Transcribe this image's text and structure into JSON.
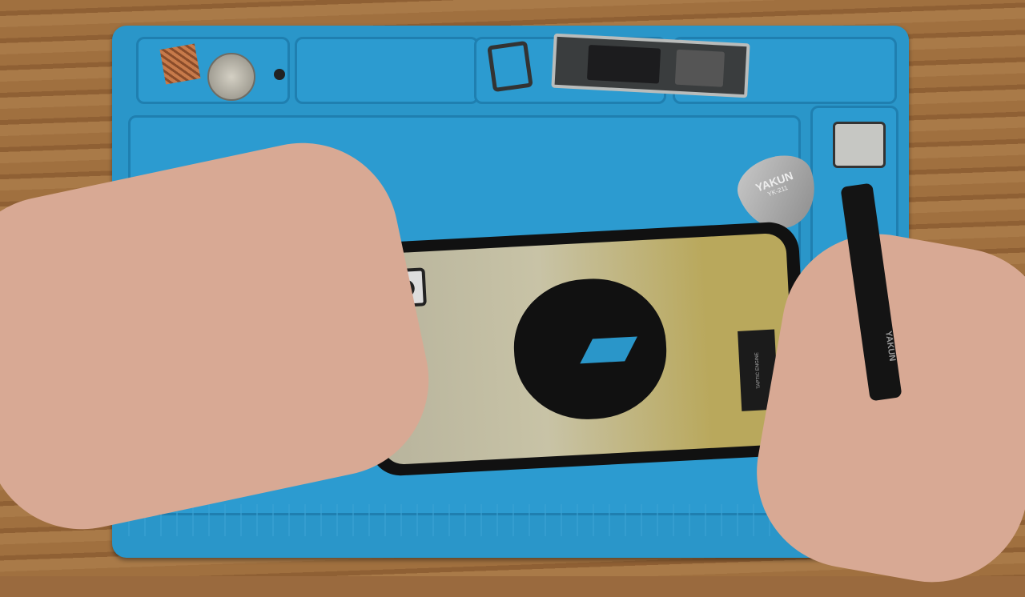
{
  "scene": {
    "description_labels": {
      "pick_brand": "YAKUN",
      "pick_model": "YK-211",
      "tweezers_brand": "YAKUN",
      "component_label": "TAPTIC ENGINE"
    },
    "colors": {
      "mat": "#2a96c9",
      "wood": "#9a6a3e",
      "skin": "#d8a994"
    }
  }
}
